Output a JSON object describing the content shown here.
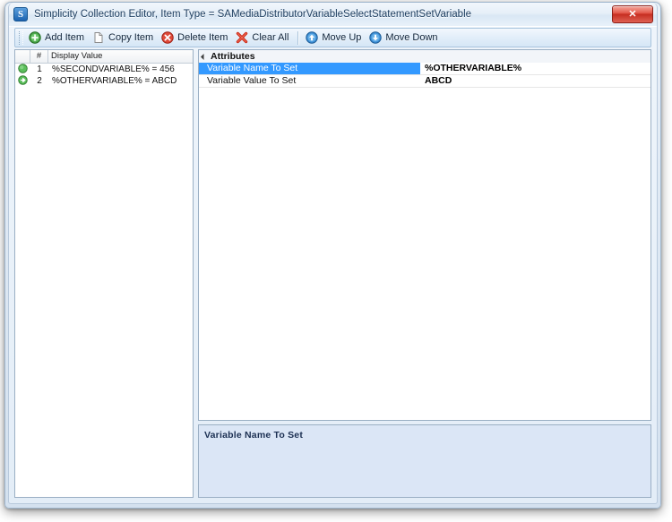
{
  "window": {
    "title": "Simplicity Collection Editor, Item Type = SAMediaDistributorVariableSelectStatementSetVariable",
    "app_icon_letter": "S",
    "close_label": "✕"
  },
  "toolbar": {
    "items": [
      {
        "label": "Add Item",
        "icon": "add-circle-icon"
      },
      {
        "label": "Copy Item",
        "icon": "copy-page-icon"
      },
      {
        "label": "Delete Item",
        "icon": "delete-circle-icon"
      },
      {
        "label": "Clear All",
        "icon": "red-x-icon"
      },
      {
        "label": "Move Up",
        "icon": "arrow-up-circle-icon"
      },
      {
        "label": "Move Down",
        "icon": "arrow-down-circle-icon"
      }
    ]
  },
  "item_list": {
    "columns": [
      "",
      "#",
      "Display Value"
    ],
    "rows": [
      {
        "marker": "bullet-icon",
        "index": "1",
        "display_value": "%SECONDVARIABLE% = 456"
      },
      {
        "marker": "arrow-right-icon",
        "index": "2",
        "display_value": "%OTHERVARIABLE% = ABCD"
      }
    ]
  },
  "property_grid": {
    "category": "Attributes",
    "rows": [
      {
        "name": "Variable Name To Set",
        "value": "%OTHERVARIABLE%",
        "selected": true
      },
      {
        "name": "Variable Value To Set",
        "value": "ABCD",
        "selected": false
      }
    ]
  },
  "description": {
    "title": "Variable Name To Set",
    "text": ""
  },
  "colors": {
    "selection_blue": "#3399ff",
    "description_bg": "#dbe6f6",
    "title_text": "#1b3c5e",
    "close_red": "#c62d20"
  }
}
